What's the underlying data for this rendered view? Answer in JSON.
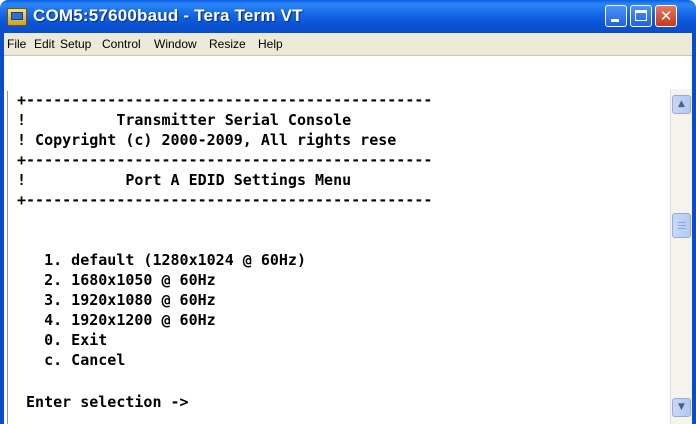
{
  "window": {
    "title": "COM5:57600baud - Tera Term VT",
    "controls": {
      "minimize_icon": "minimize-icon",
      "maximize_icon": "maximize-icon",
      "close_icon": "close-icon",
      "close_glyph": "✕"
    }
  },
  "menubar": {
    "items": [
      {
        "label": "File"
      },
      {
        "label": "Edit"
      },
      {
        "label": "Setup"
      },
      {
        "label": "Control"
      },
      {
        "label": "Window"
      },
      {
        "label": "Resize"
      },
      {
        "label": "Help"
      }
    ]
  },
  "terminal": {
    "lines": [
      "+---------------------------------------------",
      "!          Transmitter Serial Console",
      "! Copyright (c) 2000-2009, All rights rese",
      "+---------------------------------------------",
      "!           Port A EDID Settings Menu",
      "+---------------------------------------------",
      "",
      "",
      "   1. default (1280x1024 @ 60Hz)",
      "   2. 1680x1050 @ 60Hz",
      "   3. 1920x1080 @ 60Hz",
      "   4. 1920x1200 @ 60Hz",
      "   0. Exit",
      "   c. Cancel",
      "",
      " Enter selection ->"
    ]
  },
  "scrollbar": {
    "up_glyph": "▲",
    "down_glyph": "▼"
  }
}
